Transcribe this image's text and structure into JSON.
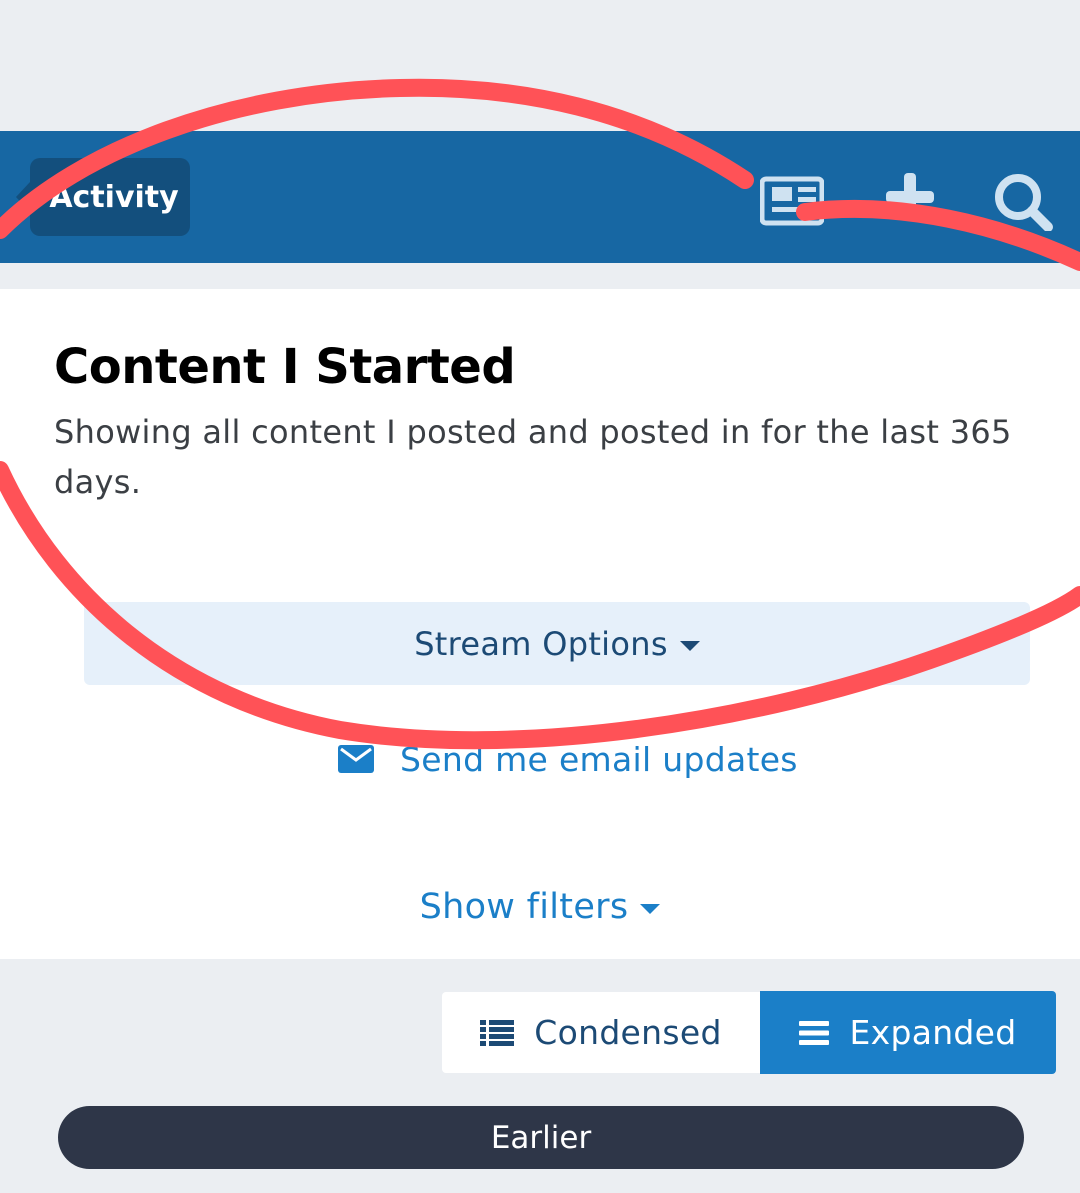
{
  "header": {
    "breadcrumb_label": "Activity",
    "icons": [
      "newspaper-icon",
      "plus-icon",
      "search-icon"
    ]
  },
  "main": {
    "title": "Content I Started",
    "description": "Showing all content I posted and posted in for the last 365 days.",
    "stream_options_label": "Stream Options",
    "email_updates_label": "Send me email updates",
    "show_filters_label": "Show filters"
  },
  "view_toggle": {
    "condensed_label": "Condensed",
    "expanded_label": "Expanded",
    "selected": "Expanded"
  },
  "timeline": {
    "earlier_label": "Earlier"
  },
  "colors": {
    "header_bg": "#1767a3",
    "breadcrumb_bg": "#134f7d",
    "link": "#1b7fc8",
    "stream_options_bg": "#e6f0fa",
    "pill_bg": "#2e3648",
    "annotation": "#ff5257"
  }
}
